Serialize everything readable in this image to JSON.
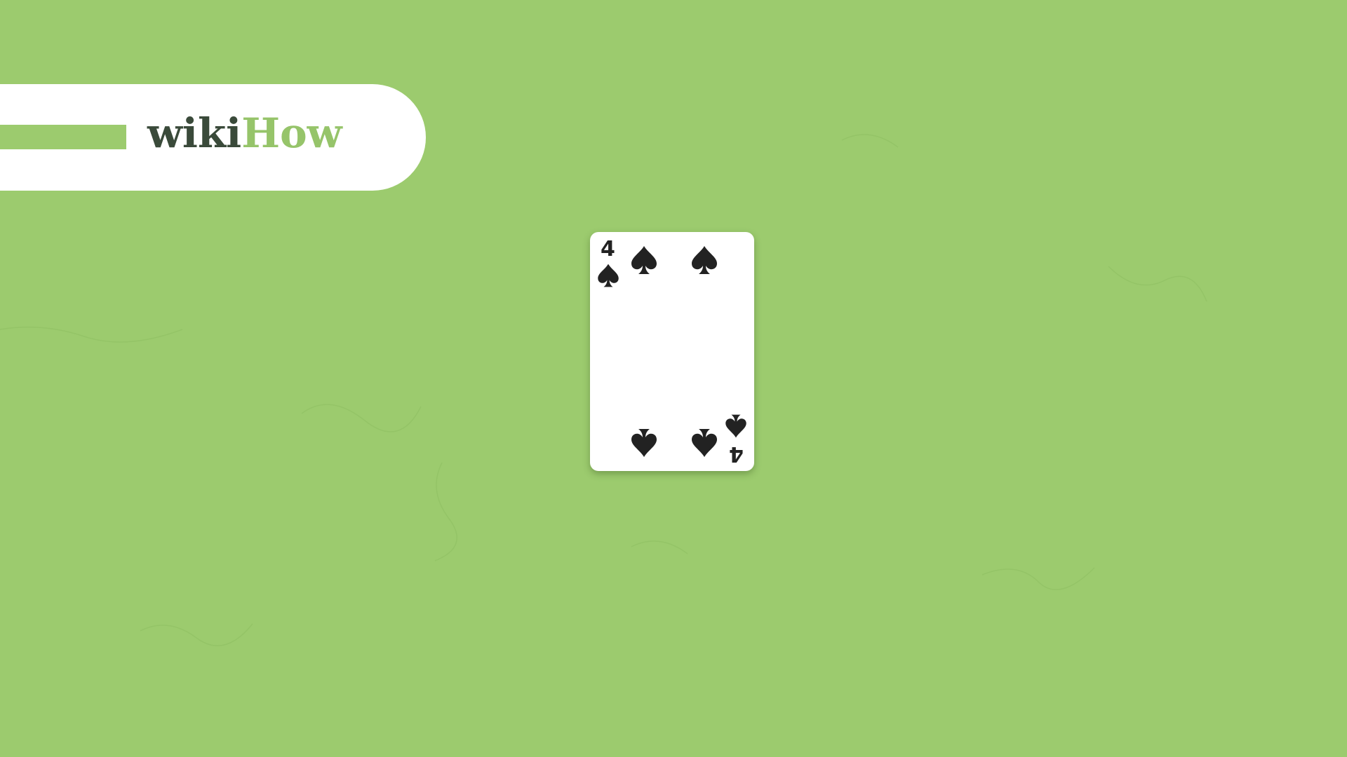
{
  "logo": {
    "wiki": "wiki",
    "how": "How"
  },
  "card": {
    "rank": "4",
    "suit": "spade-icon",
    "pip_count": 4
  },
  "colors": {
    "background": "#9ccb6e",
    "logo_dark": "#3a4a3a",
    "logo_green": "#96c46a",
    "card": "#ffffff",
    "suit": "#222222"
  }
}
